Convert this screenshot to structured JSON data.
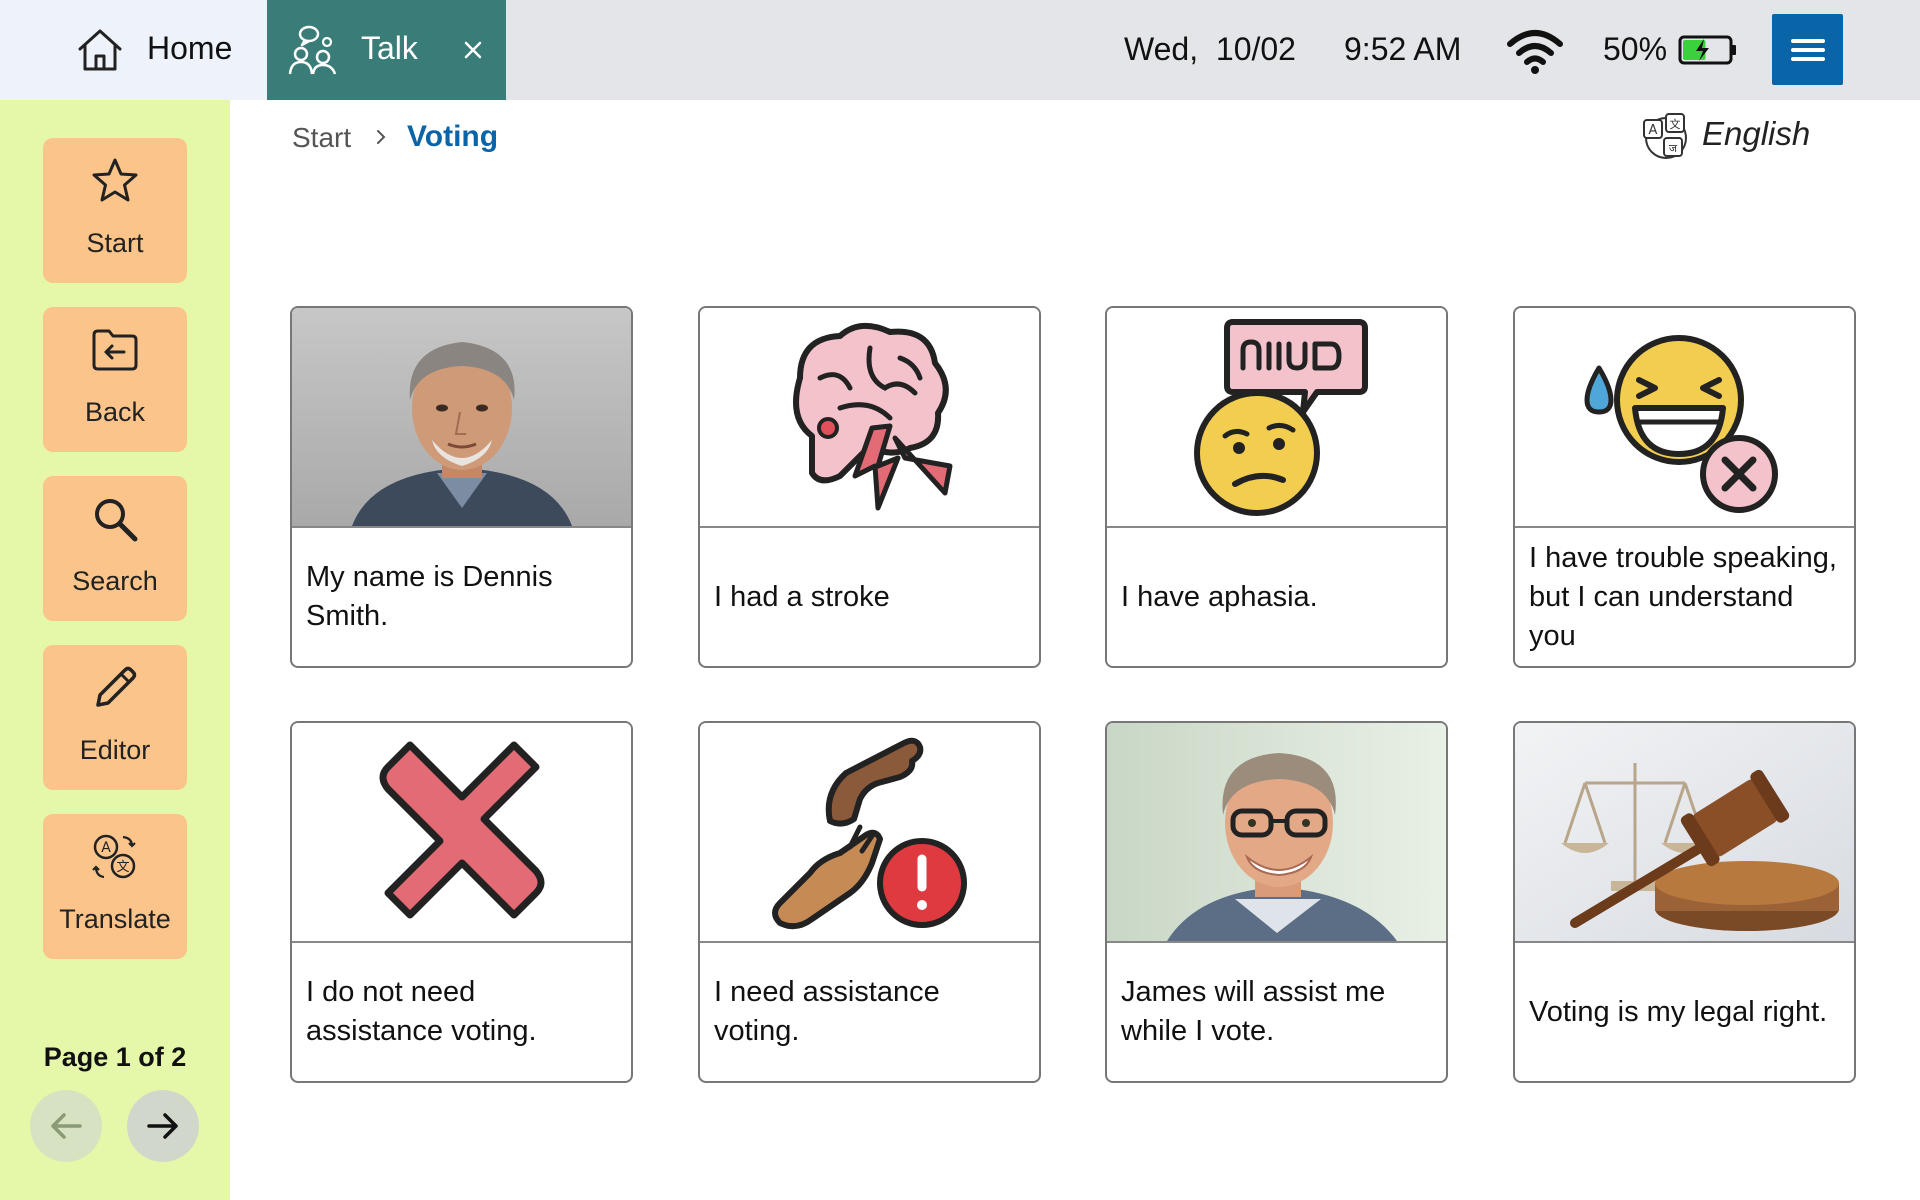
{
  "tabs": {
    "home_label": "Home",
    "talk_label": "Talk"
  },
  "status": {
    "date": "Wed,  10/02",
    "time": "9:52 AM",
    "battery": "50%",
    "battery_level": 0.5
  },
  "sidebar": {
    "items": [
      {
        "label": "Start",
        "icon": "star-icon"
      },
      {
        "label": "Back",
        "icon": "folder-back-icon"
      },
      {
        "label": "Search",
        "icon": "search-icon"
      },
      {
        "label": "Editor",
        "icon": "pencil-icon"
      },
      {
        "label": "Translate",
        "icon": "translate-icon"
      }
    ],
    "page_label": "Page 1 of 2"
  },
  "breadcrumb": {
    "start": "Start",
    "current": "Voting"
  },
  "language": "English",
  "cards": [
    {
      "text": "My name is Dennis Smith.",
      "image": "man-photo"
    },
    {
      "text": "I had a stroke",
      "image": "brain-stroke-icon"
    },
    {
      "text": "I have aphasia.",
      "image": "aphasia-face-icon"
    },
    {
      "text": "I have trouble speaking, but I can understand you",
      "image": "laughing-face-x-icon"
    },
    {
      "text": "I do not need assistance voting.",
      "image": "red-x-icon"
    },
    {
      "text": "I need assistance voting.",
      "image": "helping-hands-alert-icon"
    },
    {
      "text": "James will assist me while I vote.",
      "image": "smiling-man-photo"
    },
    {
      "text": "Voting is my legal right.",
      "image": "gavel-scales-photo"
    }
  ],
  "colors": {
    "accent": "#0a64a8",
    "talk_tab": "#3a7d78",
    "sidebar_bg": "#e5f8a9",
    "sidebar_button": "#fbc48b"
  }
}
